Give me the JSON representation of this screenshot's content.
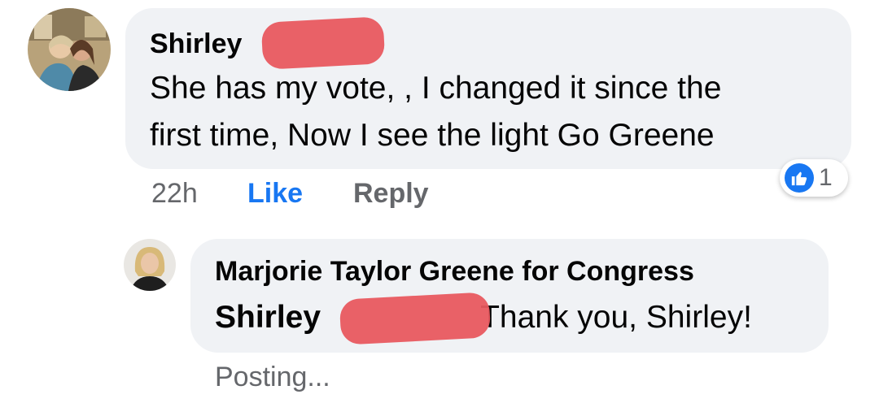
{
  "comment": {
    "author_first_name": "Shirley",
    "text_line_1": "She has my vote, ,  I changed it since the",
    "text_line_2": "first time,  Now I see the light   Go Greene",
    "timestamp": "22h",
    "like_label": "Like",
    "reply_label": "Reply",
    "reaction_icon": "like-thumb-icon",
    "reaction_count": "1"
  },
  "reply": {
    "author": "Marjorie Taylor Greene for Congress",
    "mention_first_name": "Shirley",
    "text": "Thank you, Shirley!",
    "status": "Posting..."
  },
  "colors": {
    "bubble": "#f0f2f5",
    "like_blue": "#1877f2",
    "meta_gray": "#65676b",
    "redaction": "#e8585f"
  }
}
